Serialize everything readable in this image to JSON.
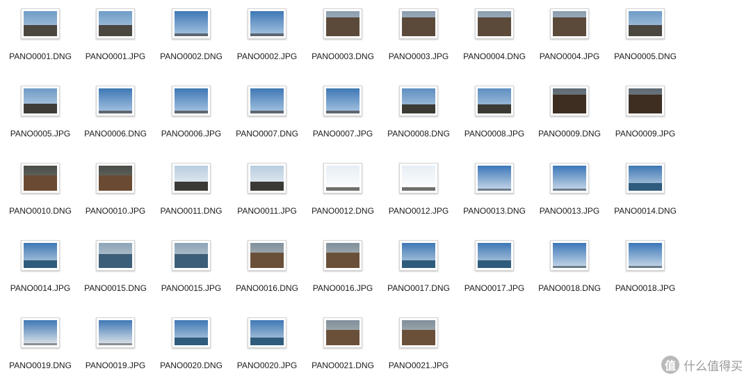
{
  "files": [
    {
      "name": "PANO0001.DNG",
      "thumb": "city"
    },
    {
      "name": "PANO0001.JPG",
      "thumb": "city"
    },
    {
      "name": "PANO0002.DNG",
      "thumb": "sky-low"
    },
    {
      "name": "PANO0002.JPG",
      "thumb": "sky-low"
    },
    {
      "name": "PANO0003.DNG",
      "thumb": "city-dense"
    },
    {
      "name": "PANO0003.JPG",
      "thumb": "city-dense"
    },
    {
      "name": "PANO0004.DNG",
      "thumb": "city-dense"
    },
    {
      "name": "PANO0004.JPG",
      "thumb": "city-dense"
    },
    {
      "name": "PANO0005.DNG",
      "thumb": "city"
    },
    {
      "name": "PANO0005.JPG",
      "thumb": "city-water"
    },
    {
      "name": "PANO0006.DNG",
      "thumb": "sky-low"
    },
    {
      "name": "PANO0006.JPG",
      "thumb": "sky-low"
    },
    {
      "name": "PANO0007.DNG",
      "thumb": "sky-low"
    },
    {
      "name": "PANO0007.JPG",
      "thumb": "sky-low"
    },
    {
      "name": "PANO0008.DNG",
      "thumb": "hills"
    },
    {
      "name": "PANO0008.JPG",
      "thumb": "hills"
    },
    {
      "name": "PANO0009.DNG",
      "thumb": "dark-land"
    },
    {
      "name": "PANO0009.JPG",
      "thumb": "dark-land"
    },
    {
      "name": "PANO0010.DNG",
      "thumb": "earth"
    },
    {
      "name": "PANO0010.JPG",
      "thumb": "earth"
    },
    {
      "name": "PANO0011.DNG",
      "thumb": "mountain"
    },
    {
      "name": "PANO0011.JPG",
      "thumb": "mountain"
    },
    {
      "name": "PANO0012.DNG",
      "thumb": "bright-mountain"
    },
    {
      "name": "PANO0012.JPG",
      "thumb": "bright-mountain"
    },
    {
      "name": "PANO0013.DNG",
      "thumb": "sky-clear"
    },
    {
      "name": "PANO0013.JPG",
      "thumb": "sky-clear"
    },
    {
      "name": "PANO0014.DNG",
      "thumb": "water"
    },
    {
      "name": "PANO0014.JPG",
      "thumb": "water"
    },
    {
      "name": "PANO0015.DNG",
      "thumb": "harbor"
    },
    {
      "name": "PANO0015.JPG",
      "thumb": "harbor"
    },
    {
      "name": "PANO0016.DNG",
      "thumb": "harbor-brown"
    },
    {
      "name": "PANO0016.JPG",
      "thumb": "harbor-brown"
    },
    {
      "name": "PANO0017.DNG",
      "thumb": "water"
    },
    {
      "name": "PANO0017.JPG",
      "thumb": "water"
    },
    {
      "name": "PANO0018.DNG",
      "thumb": "sky-clear"
    },
    {
      "name": "PANO0018.JPG",
      "thumb": "sky-clear"
    },
    {
      "name": "PANO0019.DNG",
      "thumb": "sky-haze"
    },
    {
      "name": "PANO0019.JPG",
      "thumb": "sky-haze"
    },
    {
      "name": "PANO0020.DNG",
      "thumb": "water"
    },
    {
      "name": "PANO0020.JPG",
      "thumb": "water"
    },
    {
      "name": "PANO0021.DNG",
      "thumb": "harbor-brown"
    },
    {
      "name": "PANO0021.JPG",
      "thumb": "harbor-brown"
    }
  ],
  "thumb_styles": {
    "city": {
      "sky": "#6f9cc7",
      "sky2": "#b8cde0",
      "land": "#4a4640",
      "land_ratio": 0.45
    },
    "city-water": {
      "sky": "#6e9bc8",
      "sky2": "#c2d4e4",
      "land": "#3f3c37",
      "land_ratio": 0.4
    },
    "city-dense": {
      "sky": "#8a9db0",
      "sky2": "#c5c9cc",
      "land": "#5b4a3a",
      "land_ratio": 0.75
    },
    "sky-low": {
      "sky": "#3f78b5",
      "sky2": "#a9c6e2",
      "land": "#5d6670",
      "land_ratio": 0.12
    },
    "sky-clear": {
      "sky": "#3c77b8",
      "sky2": "#c9d9e8",
      "land": "#6b7d8c",
      "land_ratio": 0.08
    },
    "sky-haze": {
      "sky": "#3f78b5",
      "sky2": "#e2e6ea",
      "land": "#8a8f94",
      "land_ratio": 0.08
    },
    "hills": {
      "sky": "#5e8fc2",
      "sky2": "#b5cbe0",
      "land": "#3b3a33",
      "land_ratio": 0.35
    },
    "dark-land": {
      "sky": "#5d6a75",
      "sky2": "#8a8b86",
      "land": "#3e2e22",
      "land_ratio": 0.75
    },
    "earth": {
      "sky": "#4a4d48",
      "sky2": "#777a70",
      "land": "#6b4a33",
      "land_ratio": 0.6
    },
    "mountain": {
      "sky": "#b9cde0",
      "sky2": "#eef2f5",
      "land": "#3b3935",
      "land_ratio": 0.35
    },
    "bright-mountain": {
      "sky": "#e6eef5",
      "sky2": "#ffffff",
      "land": "#6f6f6c",
      "land_ratio": 0.15
    },
    "water": {
      "sky": "#3f78b5",
      "sky2": "#c2d4e2",
      "land": "#2f5b7c",
      "land_ratio": 0.3
    },
    "harbor": {
      "sky": "#8da4b8",
      "sky2": "#c8d2d8",
      "land": "#3d5e78",
      "land_ratio": 0.55
    },
    "harbor-brown": {
      "sky": "#7f8f9c",
      "sky2": "#c4c4bd",
      "land": "#6a5038",
      "land_ratio": 0.6
    }
  },
  "watermark": {
    "logo": "值",
    "text": "什么值得买"
  }
}
